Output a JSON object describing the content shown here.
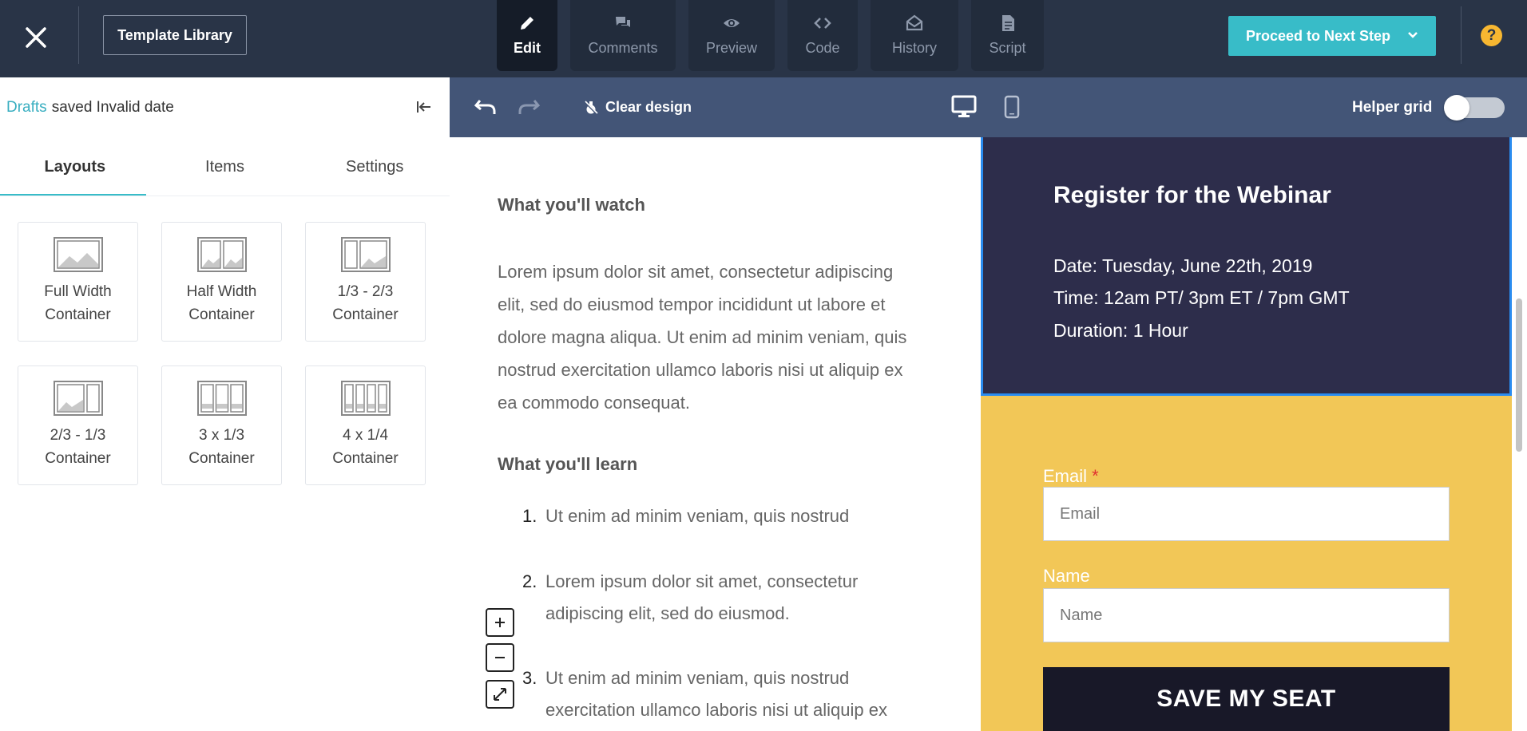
{
  "topbar": {
    "close_icon": "close-icon",
    "template_library": "Template Library",
    "tabs": [
      {
        "label": "Edit",
        "icon": "pencil-icon",
        "active": true
      },
      {
        "label": "Comments",
        "icon": "comments-icon",
        "active": false
      },
      {
        "label": "Preview",
        "icon": "eye-icon",
        "active": false
      },
      {
        "label": "Code",
        "icon": "code-icon",
        "active": false
      },
      {
        "label": "History",
        "icon": "history-icon",
        "active": false
      },
      {
        "label": "Script",
        "icon": "script-icon",
        "active": false
      }
    ],
    "proceed": "Proceed to Next Step",
    "help": "?"
  },
  "sidebar": {
    "drafts": "Drafts",
    "saved_status": "saved Invalid date",
    "tabs": [
      "Layouts",
      "Items",
      "Settings"
    ],
    "layouts": [
      {
        "label": "Full Width\nContainer",
        "icon": "full-width-layout-icon"
      },
      {
        "label": "Half Width\nContainer",
        "icon": "half-width-layout-icon"
      },
      {
        "label": "1/3 - 2/3\nContainer",
        "icon": "one-third-two-thirds-layout-icon"
      },
      {
        "label": "2/3 - 1/3\nContainer",
        "icon": "two-thirds-one-third-layout-icon"
      },
      {
        "label": "3 x 1/3\nContainer",
        "icon": "three-column-layout-icon"
      },
      {
        "label": "4 x 1/4\nContainer",
        "icon": "four-column-layout-icon"
      }
    ]
  },
  "toolbar": {
    "clear_design": "Clear design",
    "helper_grid": "Helper grid",
    "helper_grid_on": false
  },
  "content": {
    "watch_heading": "What you'll watch",
    "watch_text": "Lorem ipsum dolor sit amet, consectetur adipiscing elit, sed do eiusmod tempor incididunt ut labore et dolore magna aliqua. Ut enim ad minim veniam, quis nostrud exercitation ullamco laboris nisi ut aliquip ex ea commodo consequat.",
    "learn_heading": "What you'll learn",
    "learn_items": [
      {
        "num": "1.",
        "text": "Ut enim ad minim veniam, quis nostrud"
      },
      {
        "num": "2.",
        "text": "Lorem ipsum dolor sit amet, consectetur adipiscing elit, sed do eiusmod."
      },
      {
        "num": "3.",
        "text": "Ut enim ad minim veniam, quis nostrud exercitation ullamco laboris nisi ut aliquip ex"
      }
    ],
    "zoom_in": "+",
    "zoom_out": "−"
  },
  "webinar": {
    "title": "Register for the Webinar",
    "date": "Date: Tuesday, June 22th, 2019",
    "time": "Time: 12am PT/ 3pm ET / 7pm GMT",
    "duration": "Duration: 1 Hour"
  },
  "form": {
    "email_label": "Email",
    "required_mark": "*",
    "email_placeholder": "Email",
    "name_label": "Name",
    "name_placeholder": "Name",
    "submit": "SAVE MY SEAT"
  },
  "colors": {
    "topbar": "#293447",
    "accent": "#38bcc8",
    "editor_toolbar": "#435577",
    "webinar_bg": "#2d2d4b",
    "form_bg": "#f2c757",
    "selection_outline": "#2a8cf0"
  }
}
